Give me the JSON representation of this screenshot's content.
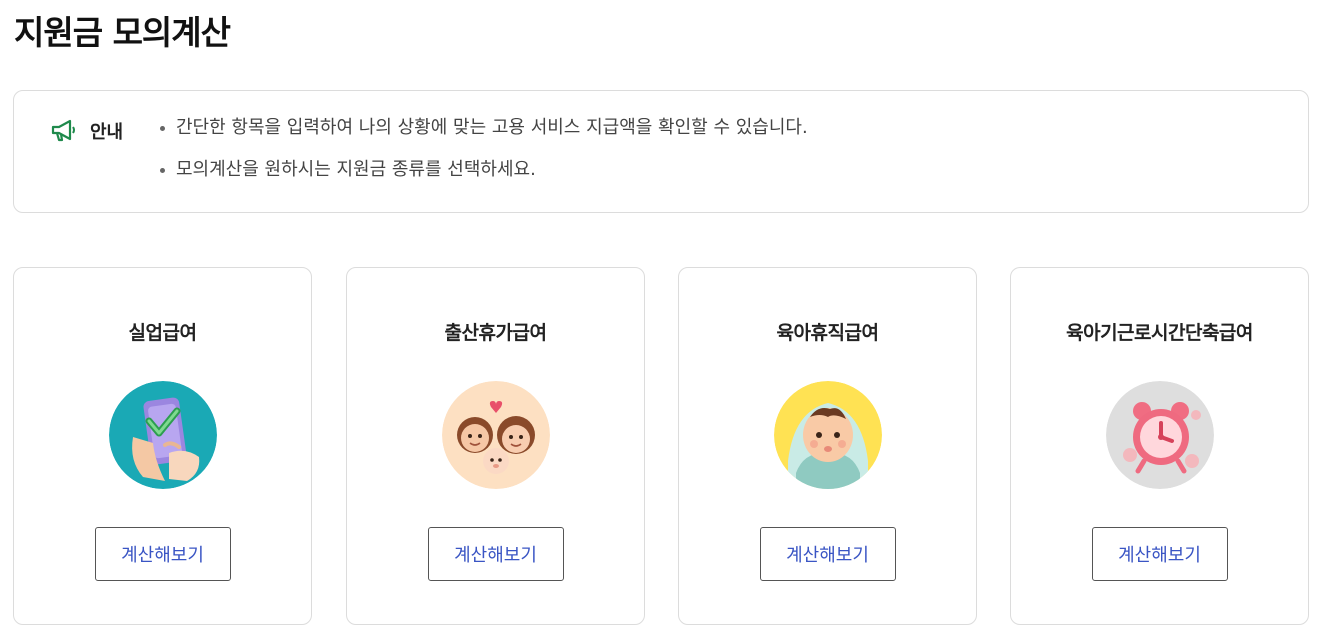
{
  "page": {
    "title": "지원금 모의계산"
  },
  "notice": {
    "label": "안내",
    "icon": "megaphone-icon",
    "items": [
      "간단한 항목을 입력하여 나의 상황에 맞는 고용 서비스 지급액을 확인할 수 있습니다.",
      "모의계산을 원하시는 지원금 종류를 선택하세요."
    ]
  },
  "cards": [
    {
      "title": "실업급여",
      "button": "계산해보기",
      "icon": "phone-check-illustration"
    },
    {
      "title": "출산휴가급여",
      "button": "계산해보기",
      "icon": "family-illustration"
    },
    {
      "title": "육아휴직급여",
      "button": "계산해보기",
      "icon": "baby-illustration"
    },
    {
      "title": "육아기근로시간단축급여",
      "button": "계산해보기",
      "icon": "alarm-clock-illustration"
    }
  ],
  "colors": {
    "accent_green": "#1f8a4c",
    "button_text": "#3a55c4",
    "card_border": "#dcdcdc"
  }
}
